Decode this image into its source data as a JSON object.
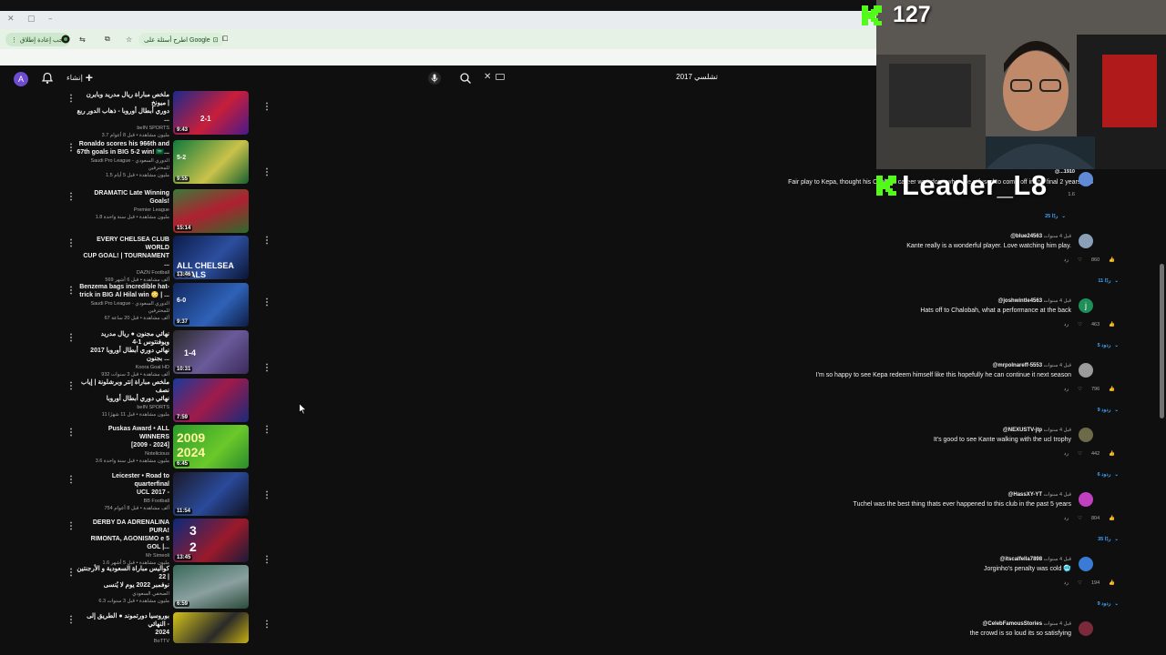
{
  "browser": {
    "toolbar": {
      "relaunch_label": "يجب إعادة إطلاق",
      "ask_google_label": "اطرح أسئلة على Google"
    }
  },
  "header": {
    "avatar_letter": "A",
    "create_label": "إنشاء",
    "search_query": "تشلسي 2017"
  },
  "videos": [
    {
      "title_1": "ملخص مباراة ريال مدريد وبايرن ميونخ |",
      "title_2": "دوري أبطال أوروبا - ذهاب الدور ربع ...",
      "channel": "beIN SPORTS",
      "meta": "3.7 مليون مشاهدة • قبل 8 أعوام",
      "duration": "9:43",
      "overlay": "2-1"
    },
    {
      "title_1": "Ronaldo scores his 966th and",
      "title_2": "67th goals in BIG 5-2 win! 🇸🇦...",
      "channel": "Saudi Pro League - الدوري السعودي للمحترفين",
      "meta": "1.5 مليون مشاهدة • قبل 5 أيام",
      "duration": "9:55",
      "overlay": "5-2"
    },
    {
      "title_1": "DRAMATIC Late Winning Goals!",
      "title_2": "",
      "channel": "Premier League",
      "meta": "1.8 مليون مشاهدة • قبل سنة واحدة",
      "duration": "15:14",
      "overlay": ""
    },
    {
      "title_1": "EVERY CHELSEA CLUB WORLD",
      "title_2": "CUP GOAL! | TOURNAMENT ...",
      "channel": "DAZN Football",
      "meta": "569 ألف مشاهدة • قبل 6 أشهر",
      "duration": "13:46",
      "overlay": "ALL CHELSEA GOALS"
    },
    {
      "title_1": "Benzema bags incredible hat-",
      "title_2": "trick in BIG Al Hilal win 😳 | ...",
      "channel": "Saudi Pro League - الدوري السعودي للمحترفين",
      "meta": "67 ألف مشاهدة • قبل 20 ساعة",
      "duration": "9:37",
      "overlay": "6-0"
    },
    {
      "title_1": "نهائي مجنون ● ريال مدريد ويوفنتوس 1-4",
      "title_2": "نهائي دوري أبطال أوروبا 2017 بجنون ...",
      "channel": "Koora Goal HD",
      "meta": "932 ألف مشاهدة • قبل 3 سنوات",
      "duration": "10:31",
      "overlay": "1-4"
    },
    {
      "title_1": "ملخص مباراة إنتر وبرشلونة | إياب نصف",
      "title_2": "نهائي دوري أبطال أوروبا",
      "channel": "beIN SPORTS",
      "meta": "11 مليون مشاهدة • قبل 11 شهرًا",
      "duration": "7:59",
      "overlay": ""
    },
    {
      "title_1": "Puskas Award • ALL WINNERS",
      "title_2": "[2009 - 2024]",
      "channel": "Notelicious",
      "meta": "3.6 مليون مشاهدة • قبل سنة واحدة",
      "duration": "6:45",
      "overlay": "2009 2024"
    },
    {
      "title_1": "Leicester • Road to quarterfinal",
      "title_2": "UCL 2017 -",
      "channel": "BB Football",
      "meta": "754 ألف مشاهدة • قبل 8 أعوام",
      "duration": "11:54",
      "overlay": ""
    },
    {
      "title_1": "DERBY DA ADRENALINA PURA!",
      "title_2": "RIMONTA, AGONISMO e 5 GOL |...",
      "channel": "Mr Simeoli",
      "meta": "1.6 مليون مشاهدة • قبل 5 أشهر",
      "duration": "13:45",
      "overlay": "3 2"
    },
    {
      "title_1": "كواليس مباراة السعودية و الأرجنتين | 22",
      "title_2": "نوفمبر 2022 يوم لا يُنسى",
      "channel": "الصحفي السعودي",
      "meta": "6.3 مليون مشاهدة • قبل 3 سنوات",
      "duration": "6:59",
      "overlay": ""
    },
    {
      "title_1": "بوروسيا دورتموند ● الطريق إلى النهائي -",
      "title_2": "2024",
      "channel": "BoTTV",
      "meta": "",
      "duration": "",
      "overlay": ""
    }
  ],
  "comments": [
    {
      "text": "Fair play to Kepa, thought his Chelsea career was done when he refused to come off in the final 2 years ago",
      "user": "",
      "time": "",
      "likes": "",
      "replies": "",
      "avatar": "",
      "color": ""
    },
    {
      "text": "",
      "user": "@...1910",
      "time": "",
      "likes": "1.6",
      "replies": "25 ردًا",
      "avatar": "",
      "color": "#5e8ad6"
    },
    {
      "text": "Kante really is a wonderful player.  Love watching him play.",
      "user": "@blue24563",
      "time": "قبل 4 سنوات",
      "likes": "860",
      "replies": "11 ردًا",
      "avatar": "",
      "color": "#8aa0b8"
    },
    {
      "text": "Hats off to Chalobah, what a performance at the back",
      "user": "@joshwintle4563",
      "time": "قبل 4 سنوات",
      "likes": "463",
      "replies": "5 ردود",
      "avatar": "j",
      "color": "#1e8e5a"
    },
    {
      "text": "I'm so happy to see Kepa redeem himself like this hopefully he can continue it next season",
      "user": "@mrpolnareff-5553",
      "time": "قبل 4 سنوات",
      "likes": "796",
      "replies": "9 ردود",
      "avatar": "",
      "color": "#9b9b9b"
    },
    {
      "text": "It's good to see Kante walking with the ucl trophy",
      "user": "@NEXUSTV-jtp",
      "time": "قبل 4 سنوات",
      "likes": "442",
      "replies": "6 ردود",
      "avatar": "",
      "color": "#6d6a4a"
    },
    {
      "text": "Tuchel was the best thing thats ever happened to this club in the past 5 years",
      "user": "@HassXY-YT",
      "time": "قبل 4 سنوات",
      "likes": "804",
      "replies": "35 ردًا",
      "avatar": "",
      "color": "#c040c0"
    },
    {
      "text": "Jorginho's penalty was cold 🥶",
      "user": "@itscalfella7898",
      "time": "قبل 4 سنوات",
      "likes": "194",
      "replies": "9 ردود",
      "avatar": "",
      "color": "#3a7bd5"
    },
    {
      "text": "the crowd is so loud its so satisfying",
      "user": "@CelebFamousStories",
      "time": "قبل 4 سنوات",
      "likes": "",
      "replies": "",
      "avatar": "",
      "color": "#7a2a3a"
    }
  ],
  "stream": {
    "kill_count": "127",
    "streamer_name": "Leader_L8",
    "brand_color": "#53fc18"
  }
}
